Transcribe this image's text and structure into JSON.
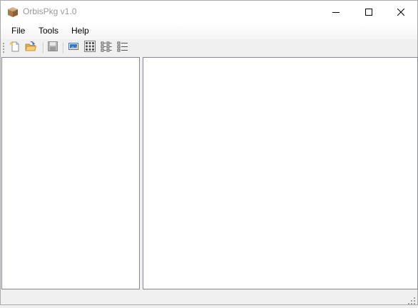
{
  "window": {
    "title": "OrbisPkg v1.0",
    "icon": "package-box-icon",
    "controls": [
      "minimize-icon",
      "maximize-icon",
      "close-icon"
    ]
  },
  "menu": {
    "file": "File",
    "tools": "Tools",
    "help": "Help"
  },
  "toolbar": {
    "buttons": [
      {
        "icon": "new-file-icon"
      },
      {
        "icon": "open-folder-icon"
      },
      {
        "icon": "save-disk-icon"
      },
      {
        "icon": "image-view-icon"
      },
      {
        "icon": "large-icons-view-icon"
      },
      {
        "icon": "small-icons-view-icon"
      },
      {
        "icon": "list-view-icon"
      }
    ]
  }
}
